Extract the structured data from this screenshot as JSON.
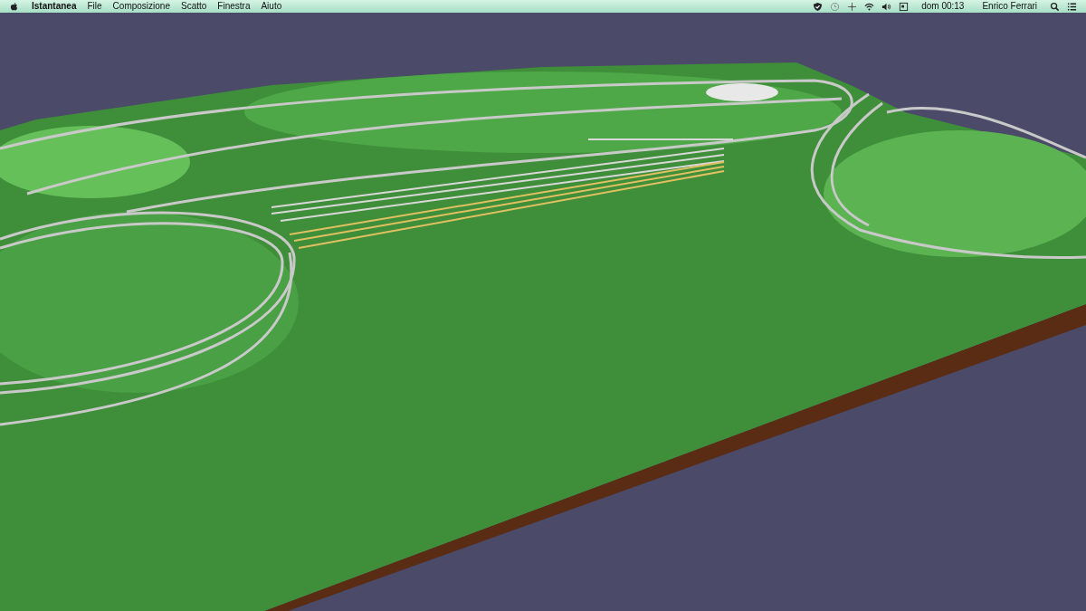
{
  "menu_bar": {
    "app_name": "Istantanea",
    "menus": [
      {
        "label": "File"
      },
      {
        "label": "Composizione"
      },
      {
        "label": "Scatto"
      },
      {
        "label": "Finestra"
      },
      {
        "label": "Aiuto"
      }
    ],
    "clock": "dom 00:13",
    "user": "Enrico Ferrari"
  }
}
